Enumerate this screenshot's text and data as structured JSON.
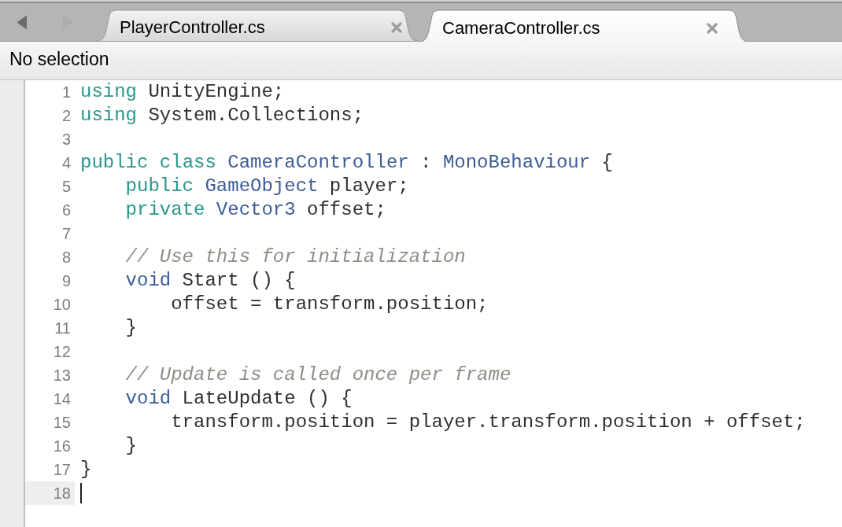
{
  "navigation": [
    {
      "kind": "back",
      "disabled": false
    },
    {
      "kind": "forward",
      "disabled": true
    }
  ],
  "tabs": [
    {
      "label": "PlayerController.cs",
      "selected": false
    },
    {
      "label": "CameraController.cs",
      "selected": true
    }
  ],
  "status_bar": {
    "text": "No selection"
  },
  "editor": {
    "lines": [
      {
        "number": "1",
        "current": false,
        "tokens": [
          {
            "text": "using",
            "kind": "keyword"
          },
          {
            "text": " UnityEngine;",
            "kind": "plain"
          }
        ]
      },
      {
        "number": "2",
        "current": false,
        "tokens": [
          {
            "text": "using",
            "kind": "keyword"
          },
          {
            "text": " System.Collections;",
            "kind": "plain"
          }
        ]
      },
      {
        "number": "3",
        "current": false
      },
      {
        "number": "4",
        "current": false,
        "tokens": [
          {
            "text": "public",
            "kind": "keyword"
          },
          {
            "text": " class",
            "kind": "keyword"
          },
          {
            "text": " CameraController",
            "kind": "type"
          },
          {
            "text": " : ",
            "kind": "plain"
          },
          {
            "text": "MonoBehaviour",
            "kind": "type"
          },
          {
            "text": " {",
            "kind": "plain"
          }
        ]
      },
      {
        "number": "5",
        "current": false,
        "tokens": [
          {
            "text": "    public",
            "kind": "keyword"
          },
          {
            "text": " GameObject",
            "kind": "type"
          },
          {
            "text": " player;",
            "kind": "plain"
          }
        ]
      },
      {
        "number": "6",
        "current": false,
        "tokens": [
          {
            "text": "    private",
            "kind": "keyword"
          },
          {
            "text": " Vector3",
            "kind": "type"
          },
          {
            "text": " offset;",
            "kind": "plain"
          }
        ]
      },
      {
        "number": "7",
        "current": false
      },
      {
        "number": "8",
        "current": false,
        "tokens": [
          {
            "text": "    // Use this for initialization",
            "kind": "comment"
          }
        ]
      },
      {
        "number": "9",
        "current": false,
        "tokens": [
          {
            "text": "    void",
            "kind": "type"
          },
          {
            "text": " Start () {",
            "kind": "plain"
          }
        ]
      },
      {
        "number": "10",
        "current": false,
        "tokens": [
          {
            "text": "        offset = transform.position;",
            "kind": "plain"
          }
        ]
      },
      {
        "number": "11",
        "current": false,
        "tokens": [
          {
            "text": "    }",
            "kind": "plain"
          }
        ]
      },
      {
        "number": "12",
        "current": false
      },
      {
        "number": "13",
        "current": false,
        "tokens": [
          {
            "text": "    // Update is called once per frame",
            "kind": "comment"
          }
        ]
      },
      {
        "number": "14",
        "current": false,
        "tokens": [
          {
            "text": "    void",
            "kind": "type"
          },
          {
            "text": " LateUpdate () {",
            "kind": "plain"
          }
        ]
      },
      {
        "number": "15",
        "current": false,
        "tokens": [
          {
            "text": "        transform.position = player.transform.position + offset;",
            "kind": "plain"
          }
        ]
      },
      {
        "number": "16",
        "current": false,
        "tokens": [
          {
            "text": "    }",
            "kind": "plain"
          }
        ]
      },
      {
        "number": "17",
        "current": false,
        "tokens": [
          {
            "text": "}",
            "kind": "plain"
          }
        ]
      },
      {
        "number": "18",
        "current": true
      }
    ]
  }
}
